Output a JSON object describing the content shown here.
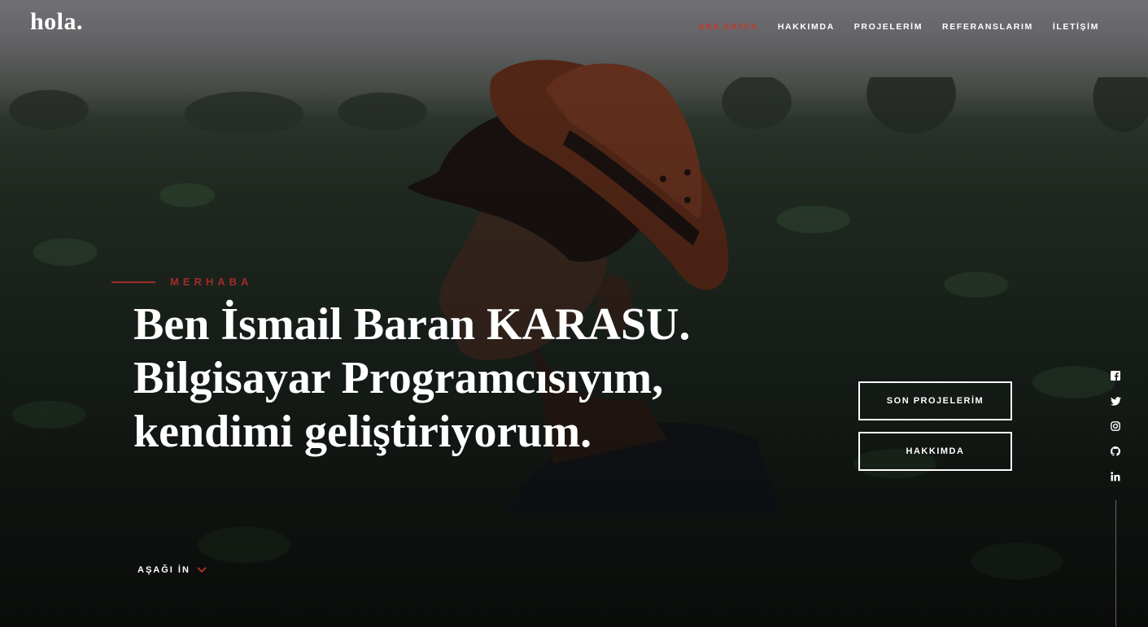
{
  "brand": {
    "logo": "hola."
  },
  "nav": {
    "items": [
      {
        "label": "ANA SAYFA",
        "active": true
      },
      {
        "label": "HAKKIMDA",
        "active": false
      },
      {
        "label": "PROJELERİM",
        "active": false
      },
      {
        "label": "REFERANSLARIM",
        "active": false
      },
      {
        "label": "İLETİŞİM",
        "active": false
      }
    ]
  },
  "intro": {
    "kicker": "MERHABA",
    "lines": [
      "Ben İsmail Baran KARASU.",
      "Bilgisayar Programcısıyım,",
      "kendimi geliştiriyorum."
    ]
  },
  "buttons": {
    "projects": "SON PROJELERİM",
    "about": "HAKKIMDA"
  },
  "scroll": {
    "label": "AŞAĞI İN",
    "icon": "chevron-down-icon"
  },
  "social": [
    "facebook-icon",
    "twitter-icon",
    "instagram-icon",
    "github-icon",
    "linkedin-icon"
  ],
  "colors": {
    "accent": "#c0392b",
    "kicker": "#a32a2a"
  }
}
